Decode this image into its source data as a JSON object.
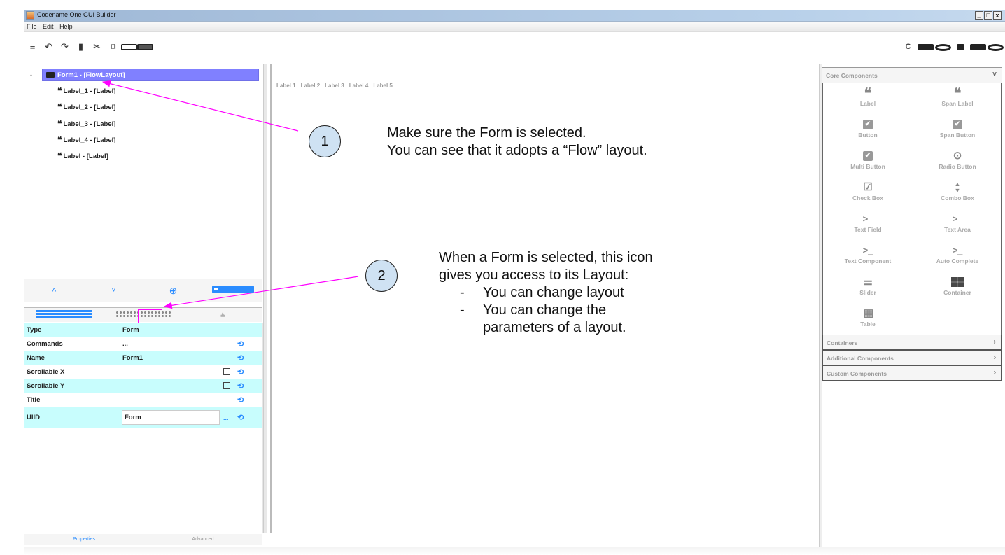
{
  "window": {
    "title": "Codename One GUI Builder",
    "controls": [
      "minimize",
      "maximize",
      "close"
    ]
  },
  "menu": [
    "File",
    "Edit",
    "Help"
  ],
  "toolbar": {
    "left": [
      {
        "icon": "menu-icon",
        "glyph": "≡"
      },
      {
        "icon": "undo-icon",
        "glyph": "↶"
      },
      {
        "icon": "redo-icon",
        "glyph": "↷"
      },
      {
        "icon": "delete-icon",
        "glyph": "▮"
      },
      {
        "icon": "cut-icon",
        "glyph": "✂"
      },
      {
        "icon": "copy-icon",
        "glyph": "⧉"
      },
      {
        "icon": "paste-icon",
        "glyph": "📋"
      },
      {
        "icon": "select-icon",
        "glyph": "▣"
      }
    ],
    "right": [
      {
        "icon": "refresh-icon",
        "glyph": "C"
      },
      {
        "icon": "preview-icon"
      },
      {
        "icon": "record-icon"
      },
      {
        "icon": "image-icon"
      },
      {
        "icon": "save-icon"
      },
      {
        "icon": "play-icon"
      }
    ]
  },
  "tree": {
    "collapse_glyph": "-",
    "root": "Form1 - [FlowLayout]",
    "children": [
      "Label_1 - [Label]",
      "Label_2 - [Label]",
      "Label_3 - [Label]",
      "Label_4 - [Label]",
      "Label - [Label]"
    ],
    "quote_glyph": "❝",
    "actions": [
      {
        "name": "move-up",
        "glyph": "˄"
      },
      {
        "name": "move-down",
        "glyph": "˅"
      },
      {
        "name": "add",
        "glyph": "⊕"
      },
      {
        "name": "add-container",
        "glyph": ""
      }
    ]
  },
  "properties": {
    "tabs": [
      "properties-list",
      "layout",
      "style"
    ],
    "rows": [
      {
        "key": "Type",
        "value": "Form",
        "reset": false,
        "checkbox": false
      },
      {
        "key": "Commands",
        "value": "...",
        "reset": true,
        "checkbox": false
      },
      {
        "key": "Name",
        "value": "Form1",
        "reset": true,
        "checkbox": false
      },
      {
        "key": "Scrollable X",
        "value": "",
        "reset": true,
        "checkbox": true
      },
      {
        "key": "Scrollable Y",
        "value": "",
        "reset": true,
        "checkbox": true
      },
      {
        "key": "Title",
        "value": "",
        "reset": true,
        "checkbox": false
      }
    ],
    "uiid": {
      "key": "UIID",
      "value": "Form",
      "more": "..."
    },
    "reset_glyph": "⟲",
    "bottom_tabs": [
      "Properties",
      "Advanced"
    ]
  },
  "canvas": {
    "labels": [
      "Label 1",
      "Label 2",
      "Label 3",
      "Label 4",
      "Label 5"
    ]
  },
  "palette": {
    "core_header": "Core Components",
    "expand_glyph": "˅",
    "collapsed_glyph": "›",
    "items": [
      {
        "label": "Label",
        "icon": "quote-icon"
      },
      {
        "label": "Span Label",
        "icon": "quote-icon"
      },
      {
        "label": "Button",
        "icon": "checkbox-filled-icon"
      },
      {
        "label": "Span Button",
        "icon": "checkbox-filled-icon"
      },
      {
        "label": "Multi Button",
        "icon": "checkbox-filled-icon"
      },
      {
        "label": "Radio Button",
        "icon": "radio-icon"
      },
      {
        "label": "Check Box",
        "icon": "checkbox-outline-icon"
      },
      {
        "label": "Combo Box",
        "icon": "updown-icon"
      },
      {
        "label": "Text Field",
        "icon": "terminal-icon"
      },
      {
        "label": "Text Area",
        "icon": "terminal-icon"
      },
      {
        "label": "Text Component",
        "icon": "terminal-icon"
      },
      {
        "label": "Auto Complete",
        "icon": "terminal-icon"
      },
      {
        "label": "Slider",
        "icon": "sliders-icon"
      },
      {
        "label": "Container",
        "icon": "grid-2x2-icon"
      },
      {
        "label": "Table",
        "icon": "table-icon"
      }
    ],
    "sections": [
      "Containers",
      "Additional Components",
      "Custom Components"
    ]
  },
  "annotations": [
    {
      "number": "1",
      "lines": [
        "Make sure the Form is selected.",
        "You can see that it adopts a “Flow” layout."
      ]
    },
    {
      "number": "2",
      "lines": [
        "When a Form is selected, this icon",
        "gives you access to its Layout:"
      ],
      "bullets": [
        "You can change layout",
        "You can change the",
        "parameters of a layout."
      ]
    }
  ],
  "colors": {
    "selection": "#8080ff",
    "property_row_alt": "#c8fdfd",
    "accent": "#2a8cff",
    "annotation_arrow": "#ff00ff",
    "bubble_fill": "#cfe2f3"
  }
}
